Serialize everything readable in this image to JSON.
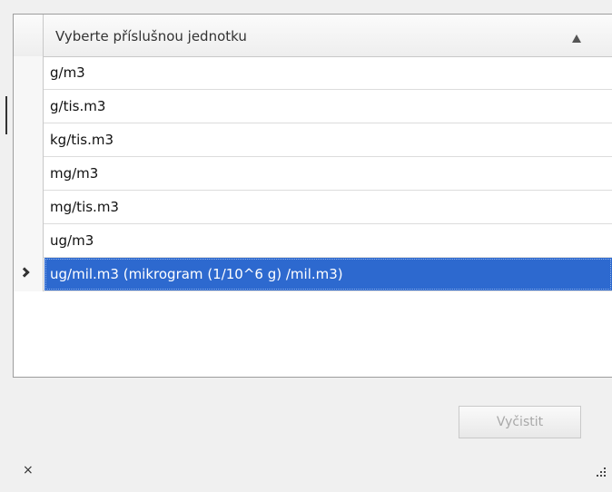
{
  "grid": {
    "header": {
      "title": "Vyberte příslušnou jednotku",
      "sort_icon": "triangle-up-icon"
    },
    "rows": [
      {
        "label": "g/m3",
        "selected": false
      },
      {
        "label": "g/tis.m3",
        "selected": false
      },
      {
        "label": "kg/tis.m3",
        "selected": false
      },
      {
        "label": "mg/m3",
        "selected": false
      },
      {
        "label": "mg/tis.m3",
        "selected": false
      },
      {
        "label": "ug/m3",
        "selected": false
      },
      {
        "label": "ug/mil.m3 (mikrogram (1/10^6 g) /mil.m3)",
        "selected": true
      }
    ],
    "selection_color": "#2d69cf"
  },
  "footer": {
    "clear_label": "Vyčistit",
    "clear_enabled": false,
    "close_label": "×",
    "resize_icon": "resize-grip-icon"
  }
}
